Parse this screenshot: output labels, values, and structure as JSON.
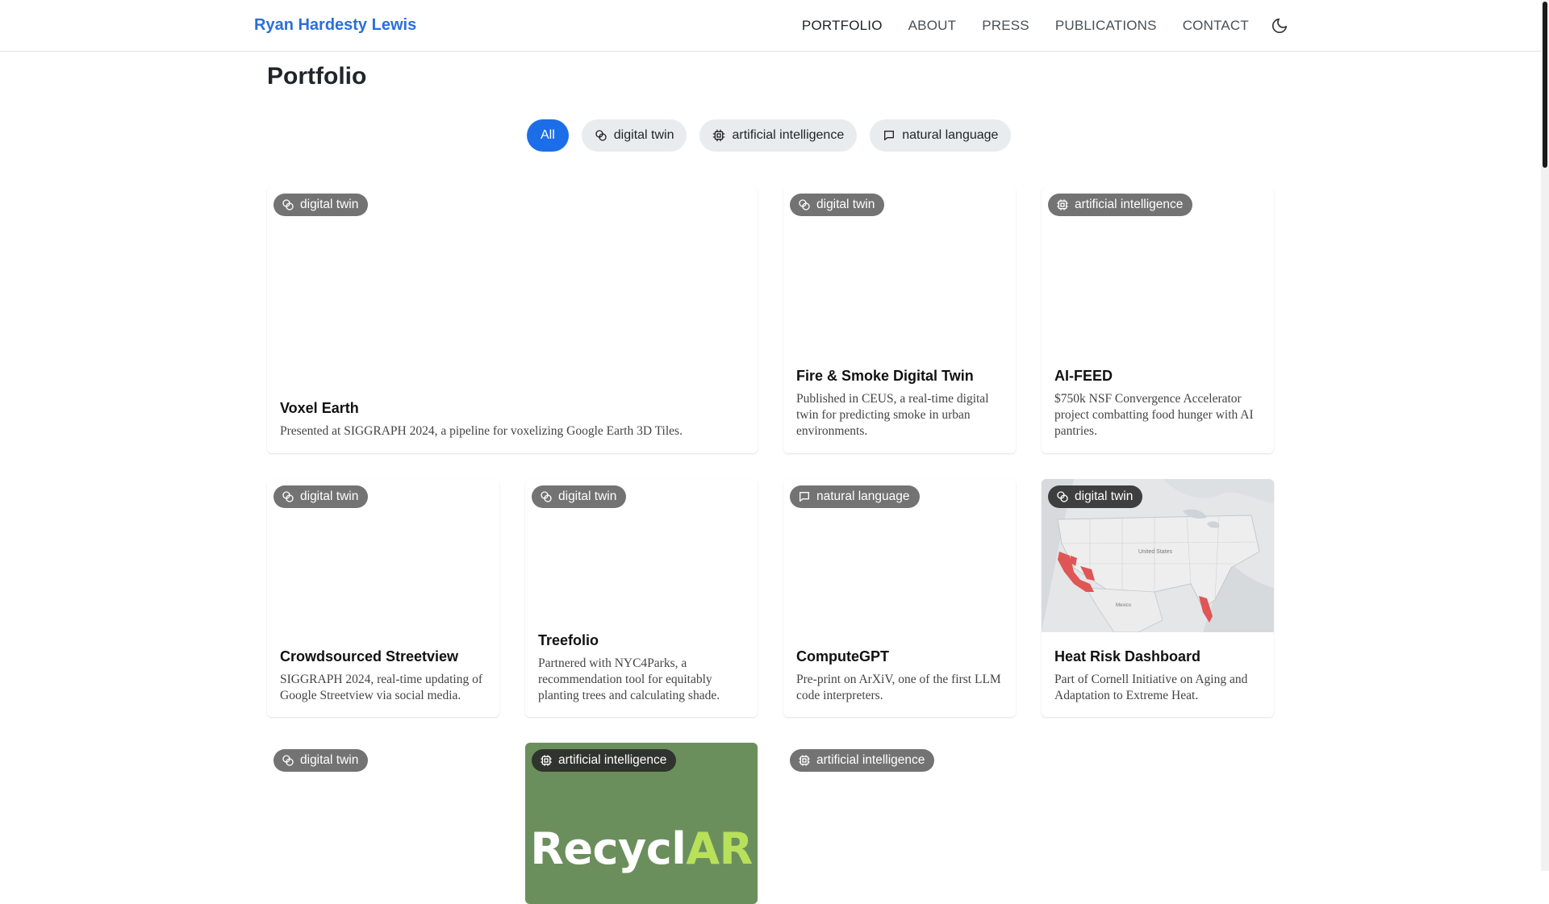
{
  "brand": "Ryan Hardesty Lewis",
  "nav": {
    "portfolio": "PORTFOLIO",
    "about": "ABOUT",
    "press": "PRESS",
    "publications": "PUBLICATIONS",
    "contact": "CONTACT",
    "theme_icon": "moon-icon"
  },
  "page_title": "Portfolio",
  "filters": {
    "all": "All",
    "digital_twin": "digital twin",
    "ai": "artificial intelligence",
    "nl": "natural language"
  },
  "colors": {
    "accent": "#1c6ee8",
    "brand": "#2a6fdb",
    "recyclar_bg": "#6b8f5c",
    "recyclar_ar": "#b8e05a"
  },
  "cards": [
    {
      "tag": "digital twin",
      "title": "Voxel Earth",
      "text": "Presented at SIGGRAPH 2024, a pipeline for voxelizing Google Earth 3D Tiles."
    },
    {
      "tag": "digital twin",
      "title": "Fire & Smoke Digital Twin",
      "text": "Published in CEUS, a real-time digital twin for predicting smoke in urban environments."
    },
    {
      "tag": "artificial intelligence",
      "title": "AI-FEED",
      "text": "$750k NSF Convergence Accelerator project combatting food hunger with AI pantries."
    },
    {
      "tag": "digital twin",
      "title": "Crowdsourced Streetview",
      "text": "SIGGRAPH 2024, real-time updating of Google Streetview via social media."
    },
    {
      "tag": "digital twin",
      "title": "Treefolio",
      "text": "Partnered with NYC4Parks, a recommendation tool for equitably planting trees and calculating shade."
    },
    {
      "tag": "natural language",
      "title": "ComputeGPT",
      "text": "Pre-print on ArXiV, one of the first LLM code interpreters."
    },
    {
      "tag": "digital twin",
      "title": "Heat Risk Dashboard",
      "text": "Part of Cornell Initiative on Aging and Adaptation to Extreme Heat.",
      "map_labels": [
        "United States",
        "Mexico"
      ]
    },
    {
      "tag": "digital twin"
    },
    {
      "tag": "artificial intelligence",
      "logo_text_a": "Recycl",
      "logo_text_b": "AR"
    },
    {
      "tag": "artificial intelligence"
    }
  ]
}
